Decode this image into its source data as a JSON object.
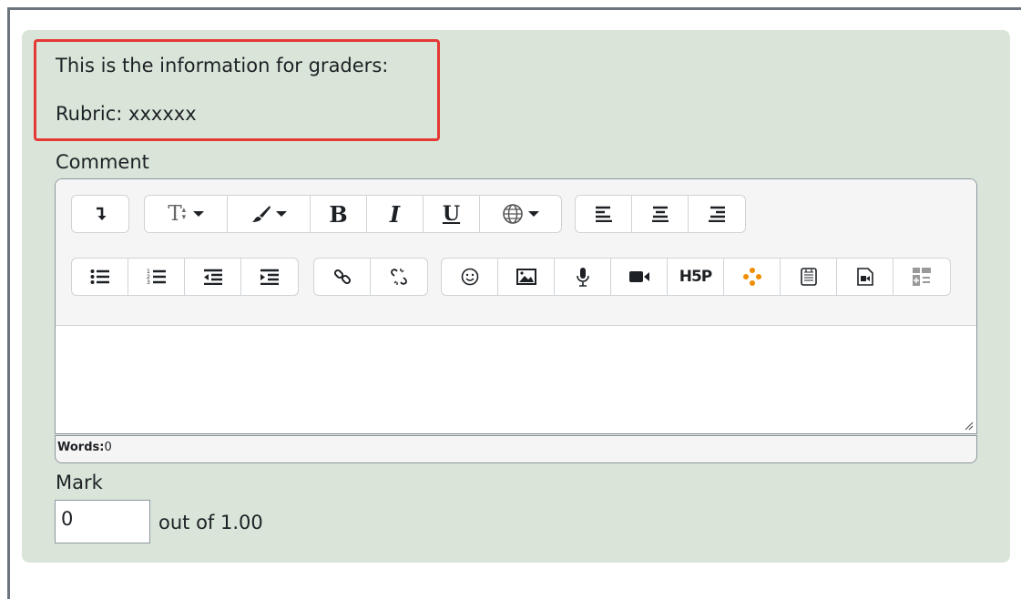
{
  "info": {
    "line1": "This is the information for graders:",
    "line2": "Rubric: xxxxxx"
  },
  "comment": {
    "label": "Comment",
    "toolbar_row1": [
      {
        "group": "collapse",
        "icons": [
          "collapse-toolbar-icon"
        ]
      },
      {
        "group": "style",
        "icons": [
          "paragraph-style-icon",
          "font-color-icon",
          "bold-icon",
          "italic-icon",
          "underline-icon",
          "language-icon"
        ]
      },
      {
        "group": "align",
        "icons": [
          "align-left-icon",
          "align-center-icon",
          "align-right-icon"
        ]
      }
    ],
    "toolbar_row2": [
      {
        "group": "lists",
        "icons": [
          "unordered-list-icon",
          "ordered-list-icon",
          "outdent-icon",
          "indent-icon"
        ]
      },
      {
        "group": "links",
        "icons": [
          "link-icon",
          "unlink-icon"
        ]
      },
      {
        "group": "media",
        "icons": [
          "emoticon-icon",
          "image-icon",
          "record-audio-icon",
          "record-video-icon",
          "h5p-icon",
          "media-dots-icon",
          "manage-files-icon",
          "media-file-icon",
          "table-icon"
        ]
      }
    ],
    "bold_glyph": "B",
    "italic_glyph": "I",
    "underline_glyph": "U",
    "text_style_glyph": "T",
    "h5p_glyph": "H5P",
    "words_label": "Words:",
    "words_count": "0"
  },
  "mark": {
    "label": "Mark",
    "value": "0",
    "suffix": "out of 1.00"
  },
  "colors": {
    "panel_bg": "#d9e5d9",
    "highlight_border": "#e53935",
    "h5p_dots": "#f08c00"
  }
}
